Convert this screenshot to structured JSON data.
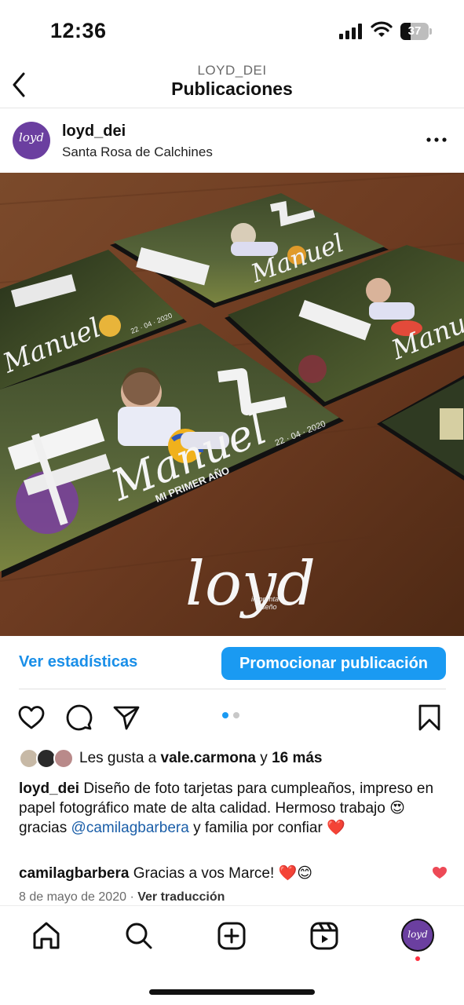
{
  "status_bar": {
    "time": "12:36",
    "battery": "37",
    "battery_level": 0.37
  },
  "header": {
    "username": "LOYD_DEI",
    "title": "Publicaciones"
  },
  "post": {
    "username": "loyd_dei",
    "location": "Santa Rosa de Calchines",
    "avatar_text": "loyd",
    "image": {
      "card_name": "Manuel",
      "card_subtitle": "MI PRIMER AÑO",
      "card_date": "22 · 04 · 2020",
      "card_number": "1",
      "logo": "loyd",
      "logo_tagline_1": "imprenta",
      "logo_tagline_2": "diseño"
    }
  },
  "actions": {
    "stats_label": "Ver estadísticas",
    "promote_label": "Promocionar publicación",
    "carousel_count": 2,
    "carousel_index": 0
  },
  "likes": {
    "prefix": "Les gusta a",
    "user": "vale.carmona",
    "connector": "y",
    "others": "16 más"
  },
  "caption": {
    "username": "loyd_dei",
    "text_1": "Diseño de foto tarjetas para cumpleaños, impreso en papel fotográfico mate de alta calidad. Hermoso trabajo",
    "emoji_1": "😍",
    "text_2": "gracias",
    "mention": "@camilagbarbera",
    "text_3": "y familia por confiar",
    "emoji_2": "❤️"
  },
  "comment": {
    "username": "camilagbarbera",
    "text": "Gracias a vos Marce!",
    "emojis": "❤️😊"
  },
  "meta": {
    "date": "8 de mayo de 2020",
    "separator": "·",
    "translate": "Ver traducción"
  },
  "colors": {
    "accent": "#1a9af2",
    "link": "#1a8fe8",
    "brand_purple": "#6b3fa0",
    "heart_red": "#ed4956"
  }
}
